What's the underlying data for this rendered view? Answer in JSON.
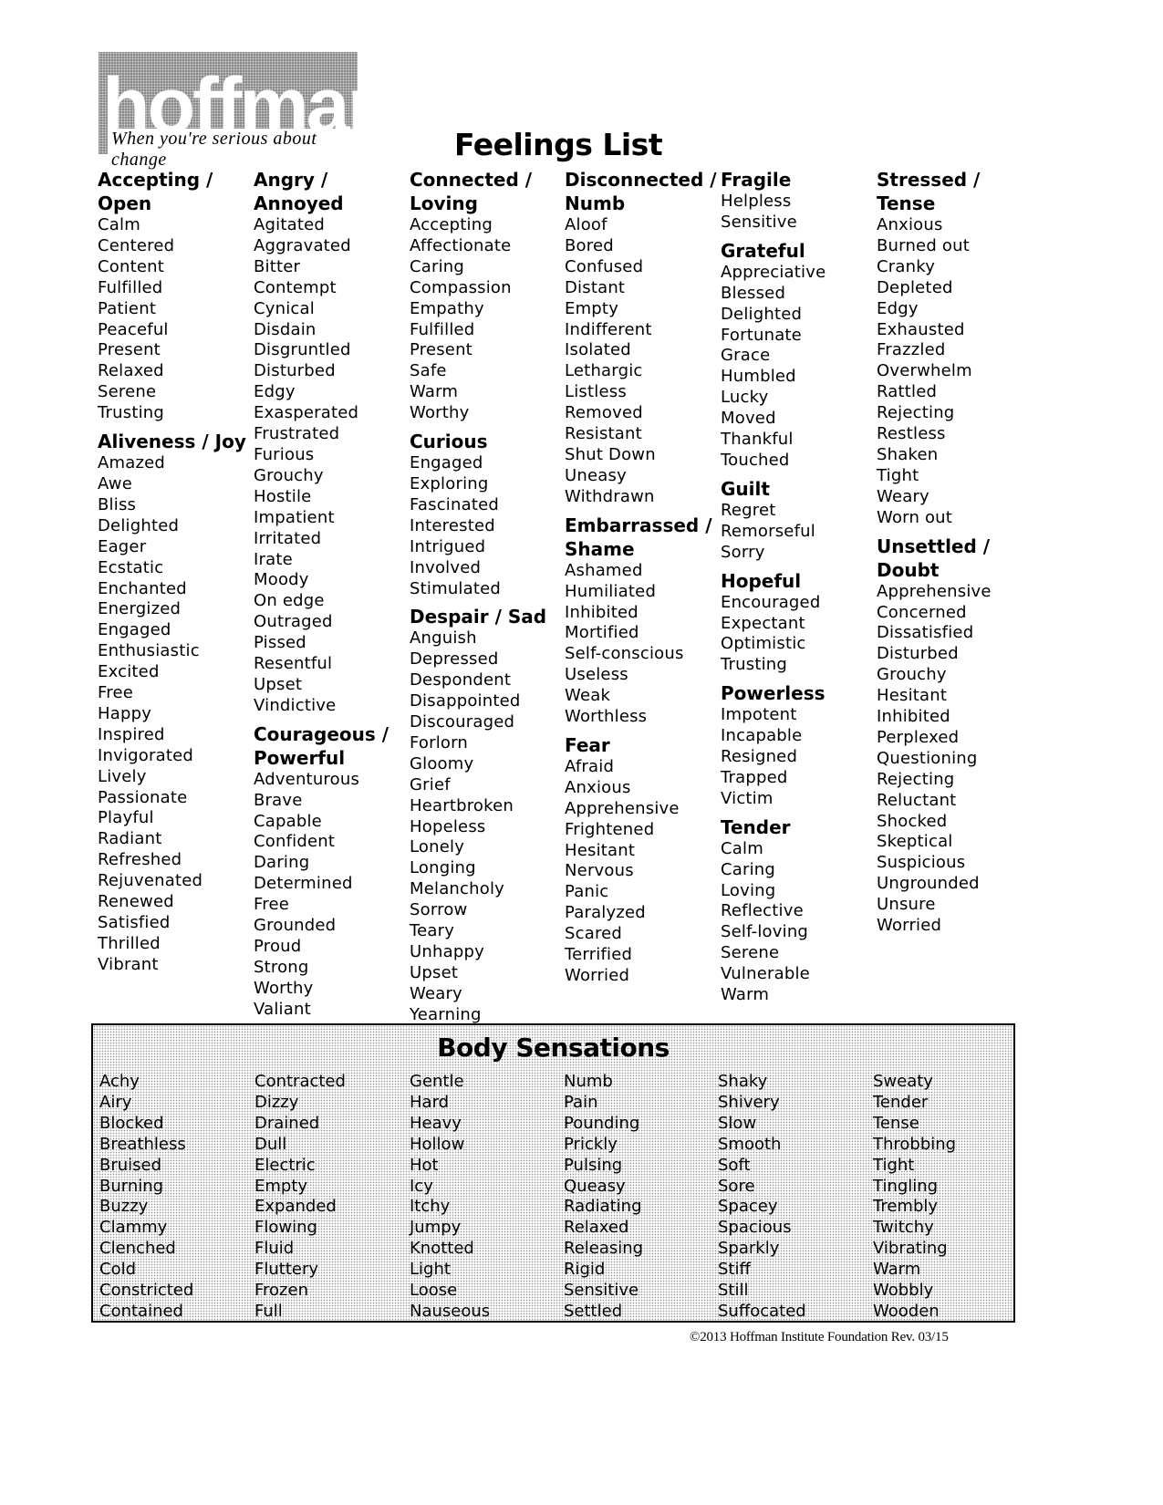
{
  "logo": {
    "word": "hoffman",
    "tagline": "When you're serious about change"
  },
  "title": "Feelings List",
  "columns": [
    {
      "categories": [
        {
          "heading": "Accepting / Open",
          "items": [
            "Calm",
            "Centered",
            "Content",
            "Fulfilled",
            "Patient",
            "Peaceful",
            "Present",
            "Relaxed",
            "Serene",
            "Trusting"
          ]
        },
        {
          "heading": "Aliveness / Joy",
          "items": [
            "Amazed",
            "Awe",
            "Bliss",
            "Delighted",
            "Eager",
            "Ecstatic",
            "Enchanted",
            "Energized",
            "Engaged",
            "Enthusiastic",
            "Excited",
            "Free",
            "Happy",
            "Inspired",
            "Invigorated",
            "Lively",
            "Passionate",
            "Playful",
            "Radiant",
            "Refreshed",
            "Rejuvenated",
            "Renewed",
            "Satisfied",
            "Thrilled",
            "Vibrant"
          ]
        }
      ]
    },
    {
      "categories": [
        {
          "heading": "Angry / Annoyed",
          "items": [
            "Agitated",
            "Aggravated",
            "Bitter",
            "Contempt",
            "Cynical",
            "Disdain",
            "Disgruntled",
            "Disturbed",
            "Edgy",
            "Exasperated",
            "Frustrated",
            "Furious",
            "Grouchy",
            "Hostile",
            "Impatient",
            "Irritated",
            "Irate",
            "Moody",
            "On edge",
            "Outraged",
            "Pissed",
            "Resentful",
            "Upset",
            "Vindictive"
          ]
        },
        {
          "heading": "Courageous / Powerful",
          "items": [
            "Adventurous",
            "Brave",
            "Capable",
            "Confident",
            "Daring",
            "Determined",
            "Free",
            "Grounded",
            "Proud",
            "Strong",
            "Worthy",
            "Valiant"
          ]
        }
      ]
    },
    {
      "categories": [
        {
          "heading": "Connected / Loving",
          "items": [
            "Accepting",
            "Affectionate",
            "Caring",
            "Compassion",
            "Empathy",
            "Fulfilled",
            "Present",
            "Safe",
            "Warm",
            "Worthy"
          ]
        },
        {
          "heading": "Curious",
          "items": [
            "Engaged",
            "Exploring",
            "Fascinated",
            "Interested",
            "Intrigued",
            "Involved",
            "Stimulated"
          ]
        },
        {
          "heading": "Despair / Sad",
          "items": [
            "Anguish",
            "Depressed",
            "Despondent",
            "Disappointed",
            "Discouraged",
            "Forlorn",
            "Gloomy",
            "Grief",
            "Heartbroken",
            "Hopeless",
            "Lonely",
            "Longing",
            "Melancholy",
            "Sorrow",
            "Teary",
            "Unhappy",
            "Upset",
            "Weary",
            "Yearning"
          ]
        }
      ]
    },
    {
      "categories": [
        {
          "heading": "Disconnected / Numb",
          "items": [
            "Aloof",
            "Bored",
            "Confused",
            "Distant",
            "Empty",
            "Indifferent",
            "Isolated",
            "Lethargic",
            "Listless",
            "Removed",
            "Resistant",
            "Shut Down",
            "Uneasy",
            "Withdrawn"
          ]
        },
        {
          "heading": "Embarrassed / Shame",
          "items": [
            "Ashamed",
            "Humiliated",
            "Inhibited",
            "Mortified",
            "Self-conscious",
            "Useless",
            "Weak",
            "Worthless"
          ]
        },
        {
          "heading": "Fear",
          "items": [
            "Afraid",
            "Anxious",
            "Apprehensive",
            "Frightened",
            "Hesitant",
            "Nervous",
            "Panic",
            "Paralyzed",
            "Scared",
            "Terrified",
            "Worried"
          ]
        }
      ]
    },
    {
      "categories": [
        {
          "heading": "Fragile",
          "items": [
            "Helpless",
            "Sensitive"
          ]
        },
        {
          "heading": "Grateful",
          "items": [
            "Appreciative",
            "Blessed",
            "Delighted",
            "Fortunate",
            "Grace",
            "Humbled",
            "Lucky",
            "Moved",
            "Thankful",
            "Touched"
          ]
        },
        {
          "heading": "Guilt",
          "items": [
            "Regret",
            "Remorseful",
            "Sorry"
          ]
        },
        {
          "heading": "Hopeful",
          "items": [
            "Encouraged",
            "Expectant",
            "Optimistic",
            "Trusting"
          ]
        },
        {
          "heading": "Powerless",
          "items": [
            "Impotent",
            "Incapable",
            "Resigned",
            "Trapped",
            "Victim"
          ]
        },
        {
          "heading": "Tender",
          "items": [
            "Calm",
            "Caring",
            "Loving",
            "Reflective",
            "Self-loving",
            "Serene",
            "Vulnerable",
            "Warm"
          ]
        }
      ]
    },
    {
      "categories": [
        {
          "heading": "Stressed / Tense",
          "items": [
            "Anxious",
            "Burned out",
            "Cranky",
            "Depleted",
            "Edgy",
            "Exhausted",
            "Frazzled",
            "Overwhelm",
            "Rattled",
            "Rejecting",
            "Restless",
            "Shaken",
            "Tight",
            "Weary",
            "Worn out"
          ]
        },
        {
          "heading": "Unsettled / Doubt",
          "items": [
            "Apprehensive",
            "Concerned",
            "Dissatisfied",
            "Disturbed",
            "Grouchy",
            "Hesitant",
            "Inhibited",
            "Perplexed",
            "Questioning",
            "Rejecting",
            "Reluctant",
            "Shocked",
            "Skeptical",
            "Suspicious",
            "Ungrounded",
            "Unsure",
            "Worried"
          ]
        }
      ]
    }
  ],
  "body_sensations": {
    "title": "Body Sensations",
    "columns": [
      [
        "Achy",
        "Airy",
        "Blocked",
        "Breathless",
        "Bruised",
        "Burning",
        "Buzzy",
        "Clammy",
        "Clenched",
        "Cold",
        "Constricted",
        "Contained"
      ],
      [
        "Contracted",
        "Dizzy",
        "Drained",
        "Dull",
        "Electric",
        "Empty",
        "Expanded",
        "Flowing",
        "Fluid",
        "Fluttery",
        "Frozen",
        "Full"
      ],
      [
        "Gentle",
        "Hard",
        "Heavy",
        "Hollow",
        "Hot",
        "Icy",
        "Itchy",
        "Jumpy",
        "Knotted",
        "Light",
        "Loose",
        "Nauseous"
      ],
      [
        "Numb",
        "Pain",
        "Pounding",
        "Prickly",
        "Pulsing",
        "Queasy",
        "Radiating",
        "Relaxed",
        "Releasing",
        "Rigid",
        "Sensitive",
        "Settled"
      ],
      [
        "Shaky",
        "Shivery",
        "Slow",
        "Smooth",
        "Soft",
        "Sore",
        "Spacey",
        "Spacious",
        "Sparkly",
        "Stiff",
        "Still",
        "Suffocated"
      ],
      [
        "Sweaty",
        "Tender",
        "Tense",
        "Throbbing",
        "Tight",
        "Tingling",
        "Trembly",
        "Twitchy",
        "Vibrating",
        "Warm",
        "Wobbly",
        "Wooden"
      ]
    ]
  },
  "footer": "©2013 Hoffman Institute Foundation Rev. 03/15"
}
